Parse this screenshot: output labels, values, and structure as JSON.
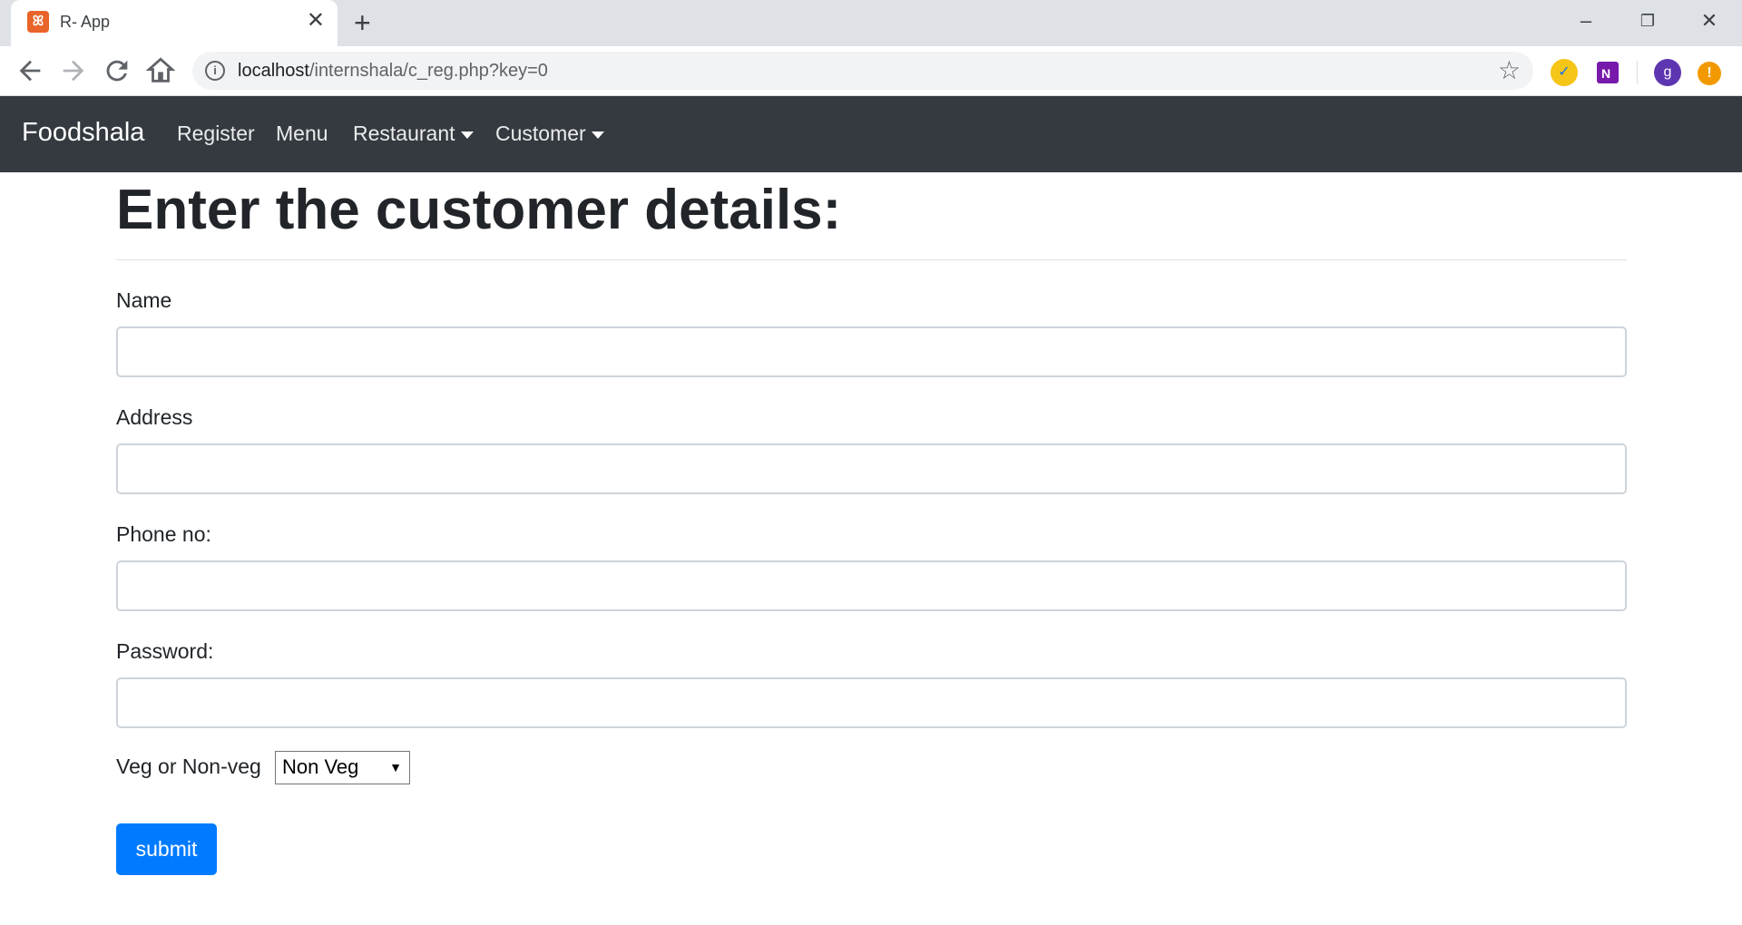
{
  "browser": {
    "tab_title": "R- App",
    "favicon_glyph": "ꕤ",
    "close_glyph": "✕",
    "newtab_glyph": "+",
    "url_host": "localhost",
    "url_path": "/internshala/c_reg.php?key=0",
    "profile_initial": "g",
    "controls": {
      "minimize": "–",
      "restore": "❐",
      "close": "✕"
    }
  },
  "navbar": {
    "brand": "Foodshala",
    "links": [
      "Register",
      "Menu",
      "Restaurant",
      "Customer"
    ]
  },
  "page": {
    "heading": "Enter the customer details:",
    "fields": [
      {
        "label": "Name",
        "value": ""
      },
      {
        "label": "Address",
        "value": ""
      },
      {
        "label": "Phone no:",
        "value": ""
      },
      {
        "label": "Password:",
        "value": ""
      }
    ],
    "diet_label": "Veg or Non-veg",
    "diet_selected": "Non Veg",
    "submit_label": "submit"
  },
  "colors": {
    "navbar_bg": "#343a40",
    "button_bg": "#007bff",
    "favicon": "#e8642a"
  }
}
